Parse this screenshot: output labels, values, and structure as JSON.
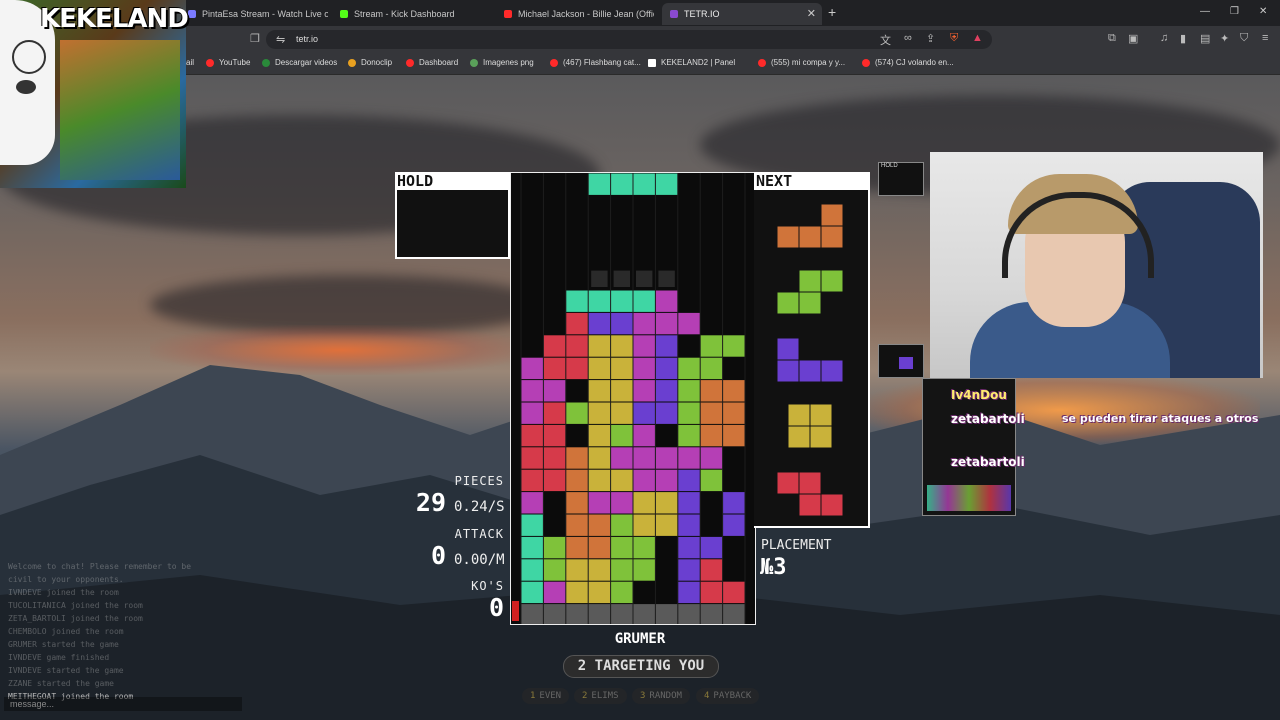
{
  "browser": {
    "tabs": [
      {
        "title": "PintaEsa Stream - Watch Live on",
        "color": "#7a7aff"
      },
      {
        "title": "Stream - Kick Dashboard",
        "color": "#53fc18"
      },
      {
        "title": "Michael Jackson - Billie Jean (Official",
        "color": "#ff2a2a"
      },
      {
        "title": "TETR.IO",
        "color": "#8a4ad0"
      }
    ],
    "url": "tetr.io",
    "bookmarks": [
      {
        "label": "ail",
        "color": "#dd4444"
      },
      {
        "label": "YouTube",
        "color": "#ff2a2a"
      },
      {
        "label": "Descargar videos",
        "color": "#2a8a3a"
      },
      {
        "label": "Donoclip",
        "color": "#e8a020"
      },
      {
        "label": "Dashboard",
        "color": "#ff2a2a"
      },
      {
        "label": "Imagenes png",
        "color": "#5aa05a"
      },
      {
        "label": "(467) Flashbang cat...",
        "color": "#ff2a2a"
      },
      {
        "label": "KEKELAND2 | Panel",
        "color": "#ffffff"
      },
      {
        "label": "(555) mi compa y y...",
        "color": "#ff2a2a"
      },
      {
        "label": "(574) CJ volando en...",
        "color": "#ff2a2a"
      }
    ]
  },
  "overlay": {
    "title": "KEKELAND"
  },
  "game": {
    "hold_label": "HOLD",
    "next_label": "NEXT",
    "stats": {
      "pieces_label": "PIECES",
      "pieces": "29",
      "pieces_rate": "0.24/S",
      "attack_label": "ATTACK",
      "attack": "0",
      "attack_rate": "0.00/M",
      "kos_label": "KO'S",
      "kos": "0"
    },
    "placement_label": "PLACEMENT",
    "placement": "№3",
    "player": "GRUMER",
    "targeting": "2 TARGETING YOU",
    "strategies": [
      {
        "num": "1",
        "label": "EVEN"
      },
      {
        "num": "2",
        "label": "ELIMS"
      },
      {
        "num": "3",
        "label": "RANDOM"
      },
      {
        "num": "4",
        "label": "PAYBACK"
      }
    ],
    "colors": {
      "cyan": "#3fd6a4",
      "purple": "#b53fb5",
      "red": "#d63a4a",
      "yellow": "#c9b23a",
      "green": "#7fc23a",
      "blue": "#6a3fd0",
      "orange": "#d0743a",
      "garbage": "#5a5a5a"
    }
  },
  "chat": {
    "lines": [
      "Welcome to chat! Please remember to be",
      "civil to your opponents.",
      "IVNDEVE joined the room",
      "TUCOLITANICA joined the room",
      "ZETA_BARTOLI joined the room",
      "CHEMBOLO joined the room",
      "GRUMER started the game",
      "IVNDEVE game finished",
      "IVNDEVE started the game",
      "ZZANE started the game"
    ],
    "last_line": "MEITHEGOAT joined the room",
    "placeholder": "message..."
  },
  "stream_chat": [
    {
      "user": "Iv4nDou",
      "text": ""
    },
    {
      "user": "zetabartoli",
      "text": "se pueden tirar ataques a otros"
    },
    {
      "user": "zetabartoli",
      "text": ""
    }
  ],
  "mini_hold": "HOLD"
}
